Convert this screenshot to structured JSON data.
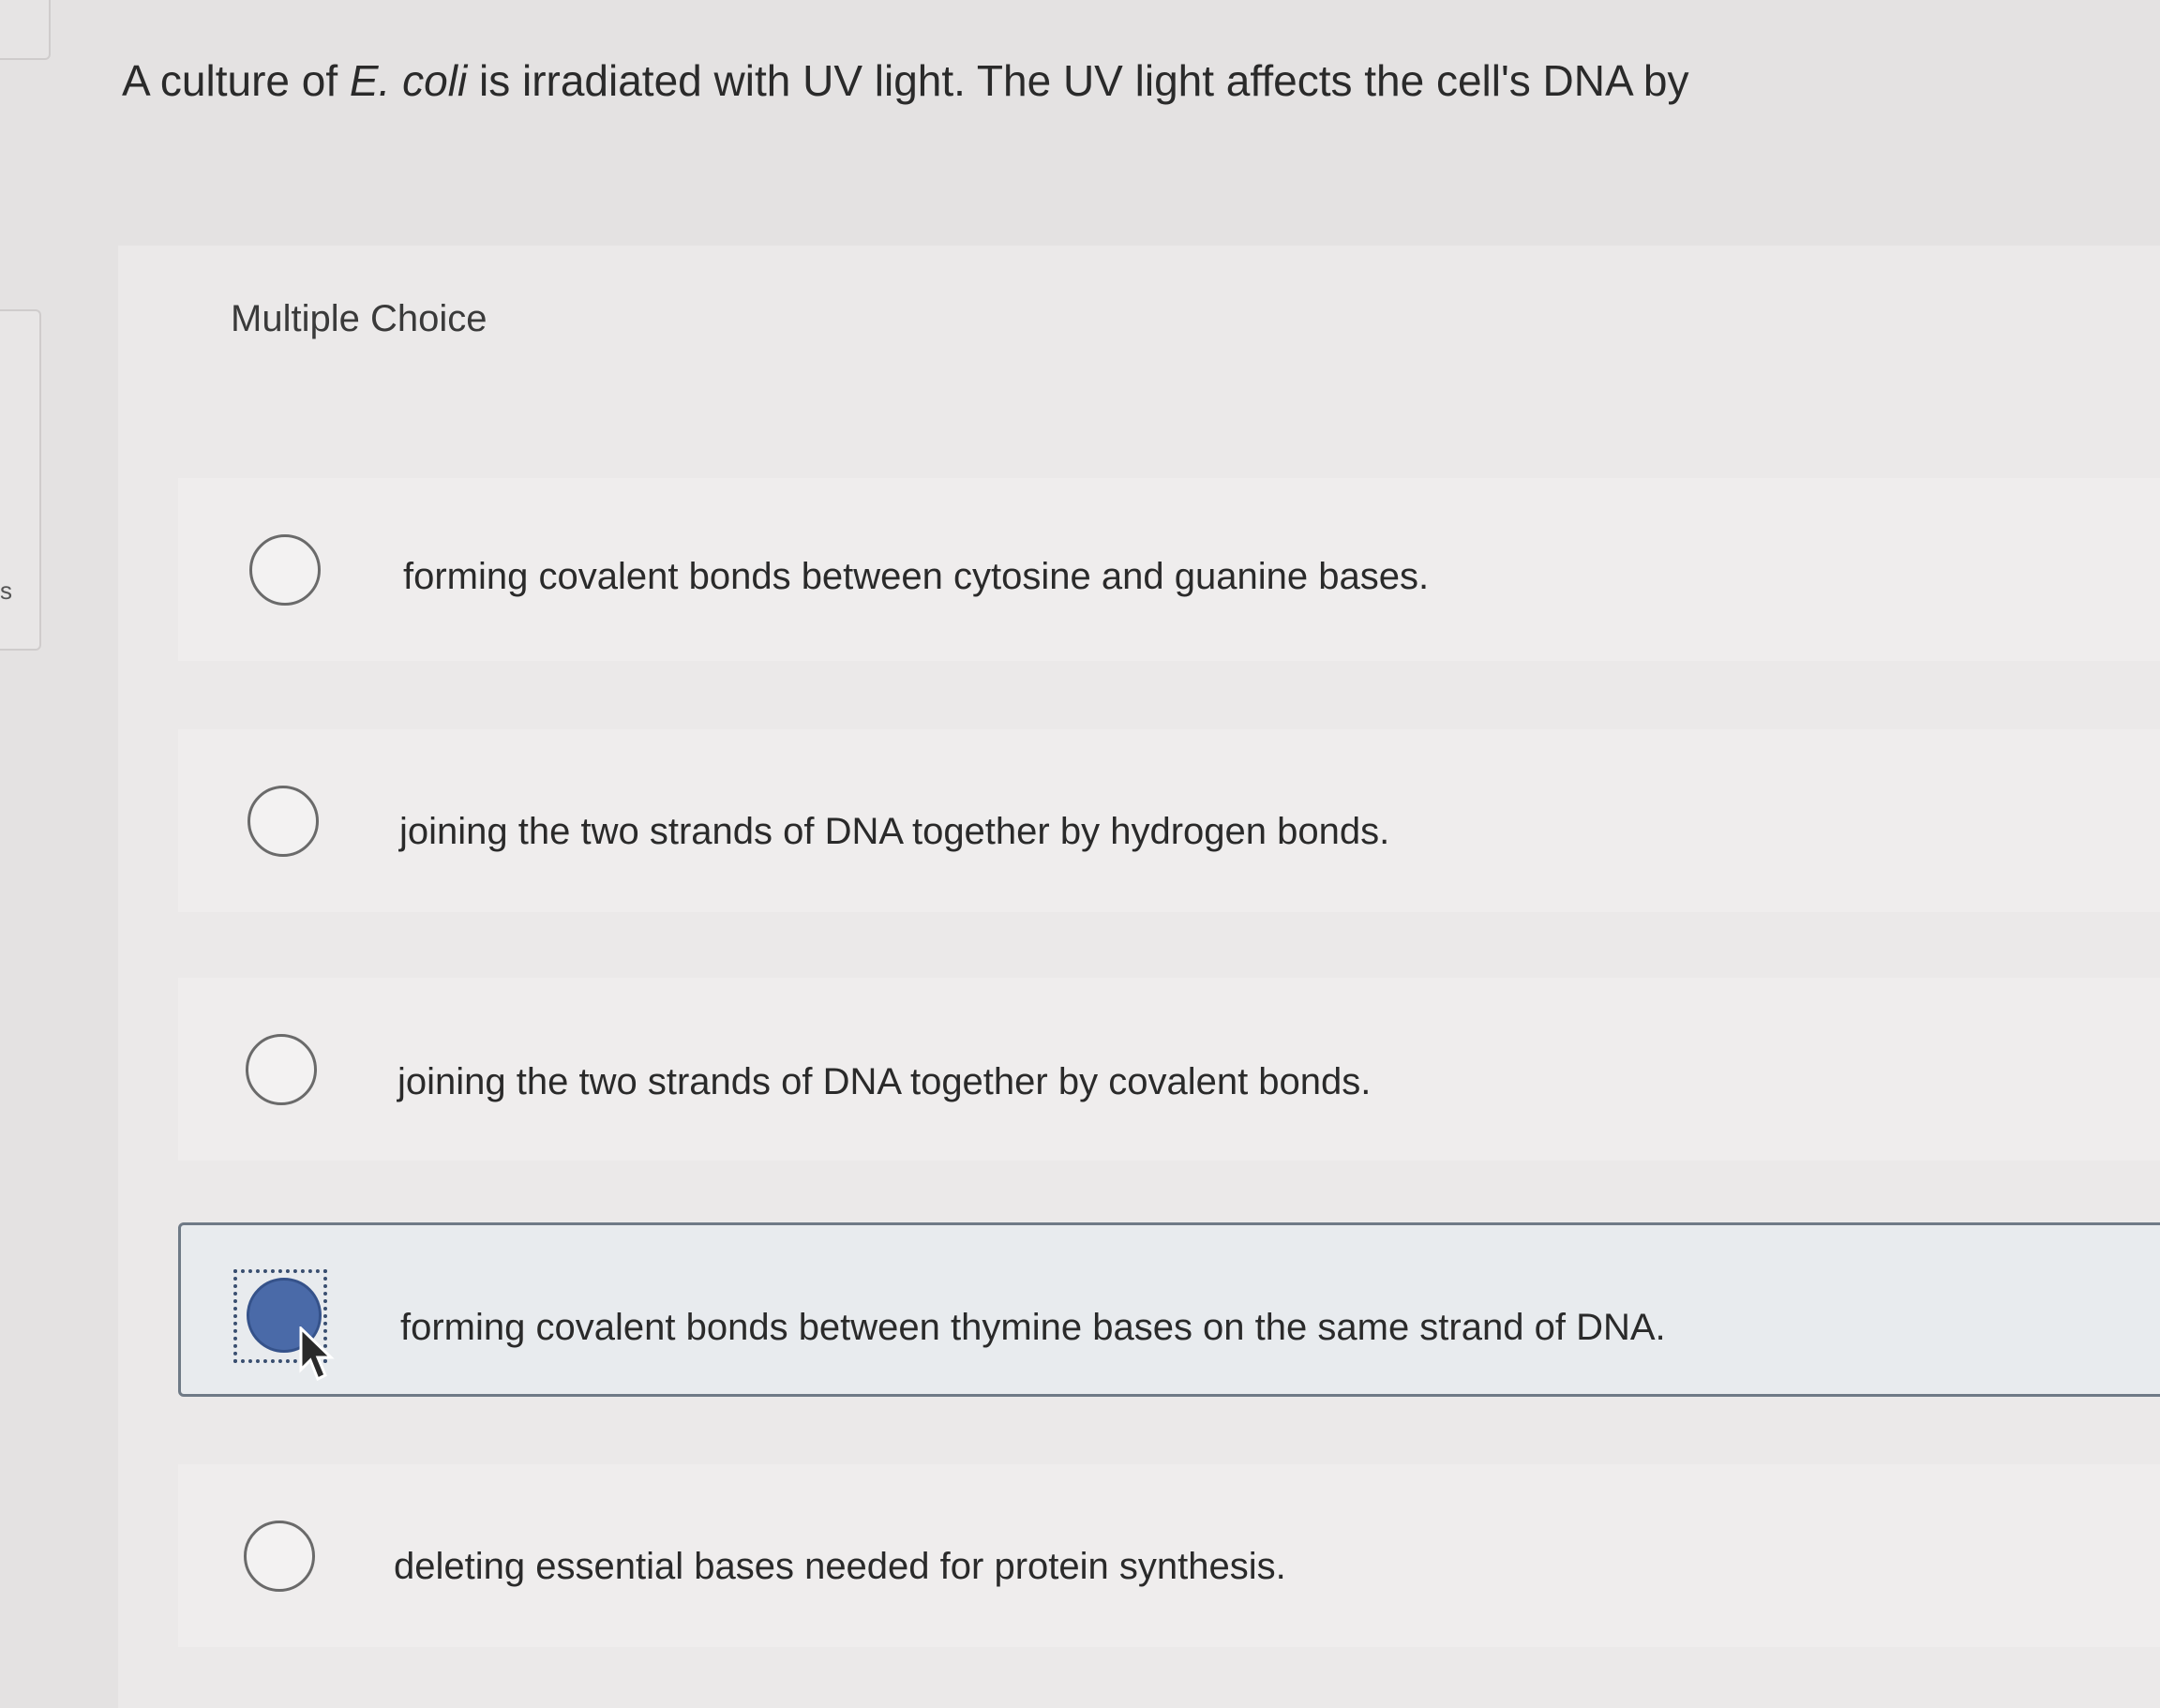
{
  "question": {
    "prefix": "A culture of ",
    "organism": "E. coli",
    "suffix": " is irradiated with UV light. The UV light affects the cell's DNA by"
  },
  "question_type": "Multiple Choice",
  "options": [
    {
      "label": "forming covalent bonds between cytosine and guanine bases.",
      "selected": false
    },
    {
      "label": "joining the two strands of DNA together by hydrogen bonds.",
      "selected": false
    },
    {
      "label": "joining the two strands of DNA together by covalent bonds.",
      "selected": false
    },
    {
      "label": "forming covalent bonds between thymine bases on the same strand of DNA.",
      "selected": true
    },
    {
      "label": "deleting essential bases needed for protein synthesis.",
      "selected": false
    }
  ],
  "colors": {
    "selected_fill": "#4a6aa8",
    "selected_border": "#6f7a86",
    "background": "#e4e2e2"
  },
  "icons": {
    "radio": "radio-button-icon",
    "radio_selected": "radio-selected-icon",
    "cursor": "mouse-pointer-icon"
  },
  "left_edge_glyph": "s"
}
